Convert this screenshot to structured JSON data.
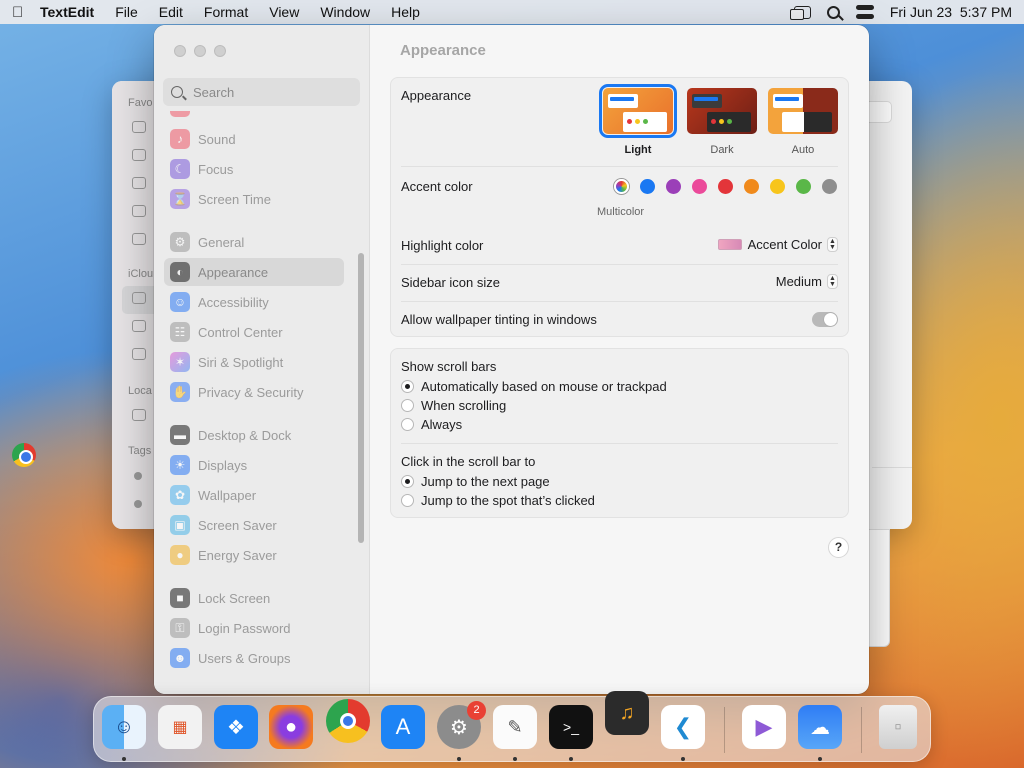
{
  "menubar": {
    "apple": "",
    "app_name": "TextEdit",
    "menus": [
      "File",
      "Edit",
      "Format",
      "View",
      "Window",
      "Help"
    ],
    "datetime": "Fri Jun 23  5:37 PM",
    "status_icons": [
      "windows-icon",
      "search-icon",
      "control-center-icon"
    ]
  },
  "finder_back": {
    "sidebar_labels": [
      "Favo",
      "iClou",
      "Loca",
      "Tags"
    ]
  },
  "settings": {
    "title": "Appearance",
    "search_placeholder": "Search",
    "sidebar_items": [
      {
        "label": "Sound",
        "color": "#f0596a",
        "icon": "speaker-icon"
      },
      {
        "label": "Focus",
        "color": "#7b5bd9",
        "icon": "moon-icon"
      },
      {
        "label": "Screen Time",
        "color": "#8e68e0",
        "icon": "hourglass-icon"
      },
      {
        "label": "General",
        "color": "#9a9a9a",
        "icon": "gear-icon"
      },
      {
        "label": "Appearance",
        "color": "#1c1c1c",
        "icon": "appearance-icon"
      },
      {
        "label": "Accessibility",
        "color": "#2f7cf6",
        "icon": "accessibility-icon"
      },
      {
        "label": "Control Center",
        "color": "#9a9a9a",
        "icon": "toggles-icon"
      },
      {
        "label": "Siri & Spotlight",
        "color": "#d24fd6",
        "icon": "siri-icon"
      },
      {
        "label": "Privacy & Security",
        "color": "#3b7df6",
        "icon": "hand-icon"
      },
      {
        "label": "Desktop & Dock",
        "color": "#1c1c1c",
        "icon": "dock-icon"
      },
      {
        "label": "Displays",
        "color": "#2f7cf6",
        "icon": "sun-icon"
      },
      {
        "label": "Wallpaper",
        "color": "#4fb3f0",
        "icon": "flower-icon"
      },
      {
        "label": "Screen Saver",
        "color": "#4cb6e8",
        "icon": "screensaver-icon"
      },
      {
        "label": "Energy Saver",
        "color": "#f4b42c",
        "icon": "bulb-icon"
      },
      {
        "label": "Lock Screen",
        "color": "#1c1c1c",
        "icon": "lock-icon"
      },
      {
        "label": "Login Password",
        "color": "#9a9a9a",
        "icon": "key-icon"
      },
      {
        "label": "Users & Groups",
        "color": "#2f7cf6",
        "icon": "users-icon"
      }
    ],
    "appearance": {
      "label": "Appearance",
      "options": [
        "Light",
        "Dark",
        "Auto"
      ],
      "selected": "Light"
    },
    "accent": {
      "label": "Accent color",
      "selected_caption": "Multicolor",
      "colors": [
        "#1a78f2",
        "#9b3fb8",
        "#eb4a9a",
        "#e3353a",
        "#f08a1c",
        "#f7c51c",
        "#5ab748",
        "#8e8e8e"
      ]
    },
    "highlight": {
      "label": "Highlight color",
      "value": "Accent Color"
    },
    "sidebar_icon_size": {
      "label": "Sidebar icon size",
      "value": "Medium"
    },
    "wallpaper_tinting": {
      "label": "Allow wallpaper tinting in windows",
      "enabled": false
    },
    "scroll_bars": {
      "label": "Show scroll bars",
      "options": [
        "Automatically based on mouse or trackpad",
        "When scrolling",
        "Always"
      ],
      "selected": 0
    },
    "click_scroll": {
      "label": "Click in the scroll bar to",
      "options": [
        "Jump to the next page",
        "Jump to the spot that’s clicked"
      ],
      "selected": 0
    },
    "help": "?"
  },
  "dock": {
    "apps": [
      "Finder",
      "Launchpad",
      "Safari",
      "Firefox",
      "Chrome",
      "App Store",
      "System Settings",
      "TextEdit",
      "Terminal",
      "GarageBand",
      "Visual Studio Code",
      "Visual Studio",
      "Weather",
      "Trash"
    ],
    "settings_badge": "2"
  }
}
